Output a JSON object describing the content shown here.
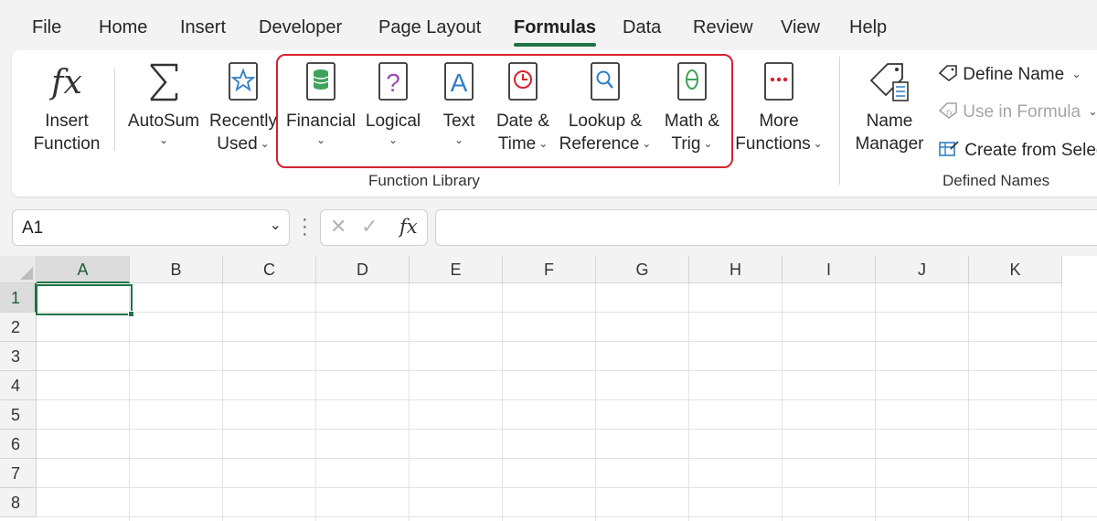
{
  "menu": {
    "tabs": [
      {
        "label": "File"
      },
      {
        "label": "Home"
      },
      {
        "label": "Insert"
      },
      {
        "label": "Developer"
      },
      {
        "label": "Page Layout"
      },
      {
        "label": "Formulas",
        "active": true
      },
      {
        "label": "Data"
      },
      {
        "label": "Review"
      },
      {
        "label": "View"
      },
      {
        "label": "Help"
      }
    ]
  },
  "ribbon": {
    "insert_function": {
      "line1": "Insert",
      "line2": "Function",
      "icon": "fx-icon"
    },
    "autosum": {
      "line1": "AutoSum",
      "icon": "sigma-icon"
    },
    "recently_used": {
      "line1": "Recently",
      "line2": "Used",
      "icon": "star-book-icon"
    },
    "financial": {
      "line1": "Financial",
      "icon": "coins-book-icon"
    },
    "logical": {
      "line1": "Logical",
      "icon": "question-book-icon"
    },
    "text": {
      "line1": "Text",
      "icon": "letter-a-book-icon"
    },
    "date_time": {
      "line1": "Date &",
      "line2": "Time",
      "icon": "clock-book-icon"
    },
    "lookup": {
      "line1": "Lookup &",
      "line2": "Reference",
      "icon": "magnifier-book-icon"
    },
    "math_trig": {
      "line1": "Math &",
      "line2": "Trig",
      "icon": "theta-book-icon"
    },
    "more_functions": {
      "line1": "More",
      "line2": "Functions",
      "icon": "ellipsis-book-icon"
    },
    "function_library_label": "Function Library",
    "name_manager": {
      "line1": "Name",
      "line2": "Manager",
      "icon": "tag-icon"
    },
    "define_name": "Define Name",
    "use_in_formula": "Use in Formula",
    "create_from_selection": "Create from Selec",
    "defined_names_label": "Defined Names"
  },
  "formula_bar": {
    "name_box": "A1",
    "fx_label": "fx",
    "formula": ""
  },
  "grid": {
    "columns": [
      "A",
      "B",
      "C",
      "D",
      "E",
      "F",
      "G",
      "H",
      "I",
      "J",
      "K"
    ],
    "rows": [
      "1",
      "2",
      "3",
      "4",
      "5",
      "6",
      "7",
      "8"
    ],
    "active_cell": "A1"
  },
  "colors": {
    "accent": "#217346",
    "highlight_border": "#d6222e"
  }
}
